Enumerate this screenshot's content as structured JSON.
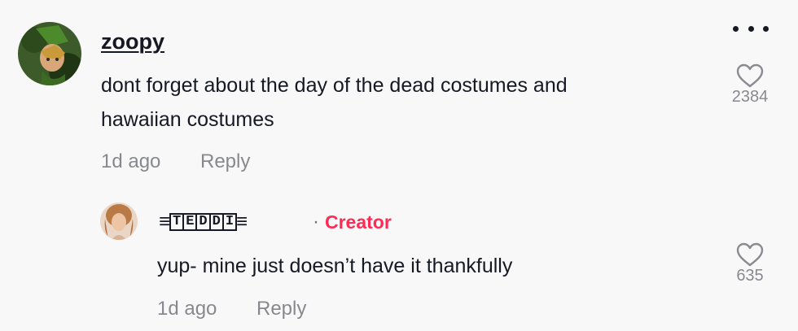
{
  "colors": {
    "background": "#f8f8f8",
    "text": "#161823",
    "muted": "#8a8b91",
    "creator": "#fe2c55"
  },
  "more_icon": "more-horizontal-icon",
  "comment": {
    "username": "zoopy",
    "text_line1": "dont forget about the day of the dead costumes and",
    "text_line2": "hawaiian costumes",
    "time": "1d ago",
    "reply_label": "Reply",
    "like_icon": "heart-outline-icon",
    "likes": "2384"
  },
  "reply": {
    "username_prefix": "≡",
    "username_letters": [
      "T",
      "E",
      "D",
      "D",
      "I"
    ],
    "username_suffix": "≡",
    "separator": "·",
    "badge": "Creator",
    "text": "yup- mine just doesn’t have it thankfully",
    "time": "1d ago",
    "reply_label": "Reply",
    "like_icon": "heart-outline-icon",
    "likes": "635"
  }
}
